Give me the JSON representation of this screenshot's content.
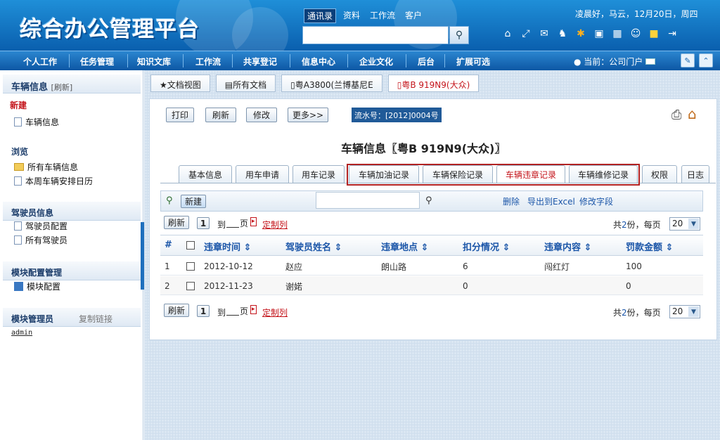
{
  "app": {
    "title": "综合办公管理平台"
  },
  "header": {
    "tabs": [
      "通讯录",
      "资料",
      "工作流",
      "客户"
    ],
    "greeting": "凌晨好，马云，12月20日，周四"
  },
  "nav": {
    "items": [
      "个人工作",
      "任务管理",
      "知识文库",
      "工作流",
      "共享登记",
      "信息中心",
      "企业文化",
      "后台",
      "扩展可选"
    ],
    "current": "当前：公司门户"
  },
  "sidebar": {
    "sec1_title": "车辆信息",
    "sec1_sub": "[刷新]",
    "new_label": "新建",
    "new_items": [
      "车辆信息"
    ],
    "sec2_title": "浏览",
    "browse_items": [
      "所有车辆信息",
      "本周车辆安排日历"
    ],
    "sec3_title": "驾驶员信息",
    "driver_items": [
      "驾驶员配置",
      "所有驾驶员"
    ],
    "sec4_title": "模块配置管理",
    "module_items": [
      "模块配置"
    ],
    "sec5_title": "模块管理员",
    "sec5_link": "复制链接",
    "admin": "admin"
  },
  "doc_tabs": [
    "★文档视图",
    "所有文档",
    "粤A3800(兰博基尼E",
    "粤B 919N9(大众)"
  ],
  "toolbar": {
    "print": "打印",
    "refresh": "刷新",
    "edit": "修改",
    "more": "更多>>",
    "flow": "流水号：[2012]0004号"
  },
  "page_title": "车辆信息〖粤B 919N9(大众)〗",
  "record_tabs": [
    "基本信息",
    "用车申请",
    "用车记录",
    "车辆加油记录",
    "车辆保险记录",
    "车辆违章记录",
    "车辆维修记录",
    "权限",
    "日志"
  ],
  "grid": {
    "new_btn": "新建",
    "delete": "删除",
    "export": "导出到Excel",
    "edit_fields": "修改字段",
    "pager": {
      "refresh": "刷新",
      "page": "1",
      "to": "到",
      "page_unit": "页",
      "custom": "定制列",
      "total_prefix": "共",
      "total": "2",
      "total_mid": "份，每页",
      "per_page": "20"
    },
    "columns": [
      "#",
      "违章时间 ⇕",
      "驾驶员姓名 ⇕",
      "违章地点 ⇕",
      "扣分情况 ⇕",
      "违章内容 ⇕",
      "罚款金额 ⇕"
    ],
    "rows": [
      {
        "idx": "1",
        "time": "2012-10-12",
        "driver": "赵应",
        "place": "朗山路",
        "points": "6",
        "content": "闯红灯",
        "fine": "100"
      },
      {
        "idx": "2",
        "time": "2012-11-23",
        "driver": "谢婼",
        "place": "",
        "points": "0",
        "content": "",
        "fine": "0"
      }
    ]
  }
}
